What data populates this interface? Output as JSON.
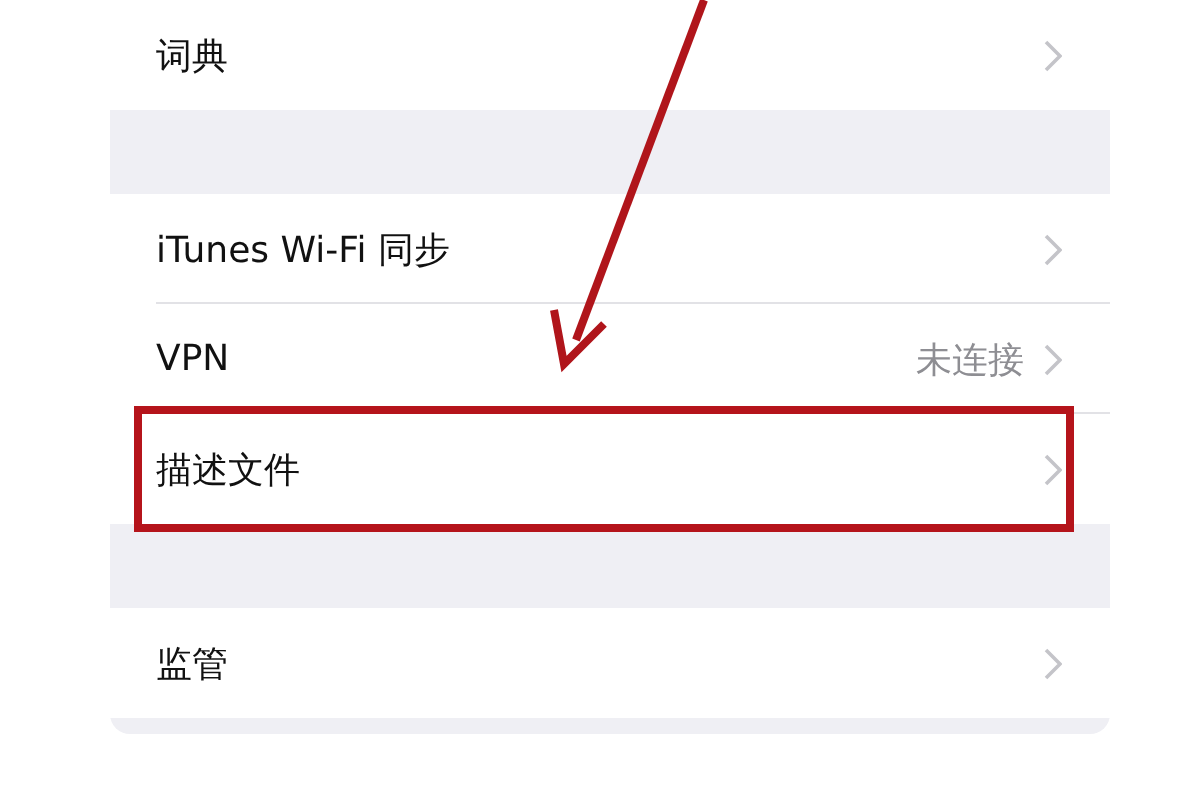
{
  "groups": [
    {
      "rows": [
        {
          "label": "词典",
          "highlighted": false
        }
      ]
    },
    {
      "rows": [
        {
          "label": "iTunes Wi-Fi 同步",
          "highlighted": false
        },
        {
          "label": "VPN",
          "value": "未连接",
          "highlighted": false
        },
        {
          "label": "描述文件",
          "highlighted": true
        }
      ]
    },
    {
      "rows": [
        {
          "label": "监管",
          "highlighted": false
        }
      ]
    }
  ]
}
